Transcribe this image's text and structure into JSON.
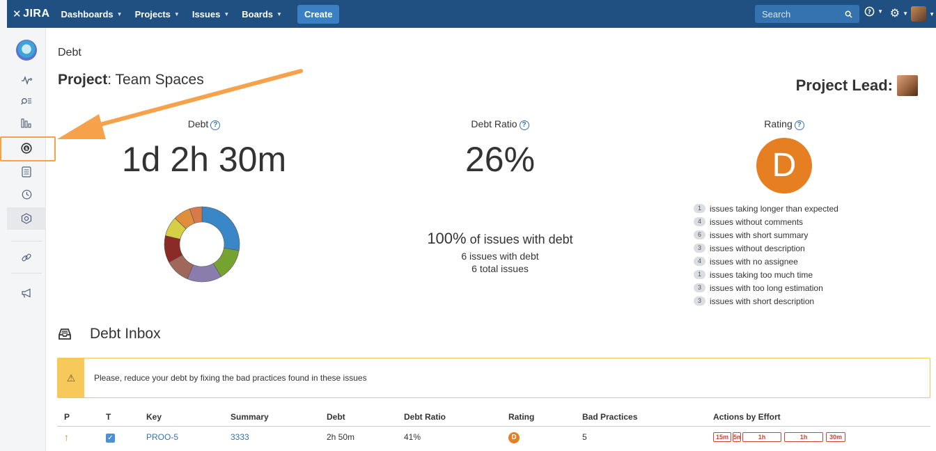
{
  "topbar": {
    "logo_text": "JIRA",
    "nav": [
      {
        "label": "Dashboards"
      },
      {
        "label": "Projects"
      },
      {
        "label": "Issues"
      },
      {
        "label": "Boards"
      }
    ],
    "create_label": "Create",
    "search_placeholder": "Search",
    "icons": [
      "search-icon",
      "help-icon",
      "gear-icon",
      "user-avatar"
    ]
  },
  "sidebar": {
    "icons": [
      "project-avatar",
      "activity-icon",
      "search-list-icon",
      "reports-icon",
      "debt-icon",
      "backlog-icon",
      "clock-icon",
      "components-icon",
      "link-icon",
      "megaphone-icon"
    ]
  },
  "page": {
    "breadcrumb": "Debt",
    "project_label": "Project",
    "project_name": ": Team Spaces",
    "project_lead_label": "Project Lead:"
  },
  "metrics": {
    "debt_label": "Debt",
    "debt_value": "1d 2h 30m",
    "ratio_label": "Debt Ratio",
    "ratio_value": "26%",
    "rating_label": "Rating",
    "rating_value": "D",
    "rating_color": "#e67e22"
  },
  "donut": {
    "segments": [
      {
        "value": 26,
        "color": "#3a87c8"
      },
      {
        "value": 13,
        "color": "#76a330"
      },
      {
        "value": 14,
        "color": "#8a7cad"
      },
      {
        "value": 10,
        "color": "#a0685a"
      },
      {
        "value": 11,
        "color": "#8b2a26"
      },
      {
        "value": 8,
        "color": "#d6cf45"
      },
      {
        "value": 7,
        "color": "#e08d3c"
      },
      {
        "value": 5,
        "color": "#d67a4a"
      }
    ]
  },
  "summary": {
    "pct": "100%",
    "pct_text": "of issues with debt",
    "with_debt": "6 issues with debt",
    "total": "6 total issues"
  },
  "bad_practices": [
    {
      "count": "1",
      "label": "issues taking longer than expected"
    },
    {
      "count": "4",
      "label": "issues without comments"
    },
    {
      "count": "6",
      "label": "issues with short summary"
    },
    {
      "count": "3",
      "label": "issues without description"
    },
    {
      "count": "4",
      "label": "issues with no assignee"
    },
    {
      "count": "1",
      "label": "issues taking too much time"
    },
    {
      "count": "3",
      "label": "issues with too long estimation"
    },
    {
      "count": "3",
      "label": "issues with short description"
    }
  ],
  "inbox": {
    "title": "Debt Inbox",
    "warning": "Please, reduce your debt by fixing the bad practices found in these issues",
    "columns": [
      "P",
      "T",
      "Key",
      "Summary",
      "Debt",
      "Debt Ratio",
      "Rating",
      "Bad Practices",
      "Actions by Effort"
    ],
    "rows": [
      {
        "key": "PROO-5",
        "summary": "3333",
        "debt": "2h 50m",
        "ratio": "41%",
        "rating": "D",
        "bad_practices": "5",
        "efforts": [
          "15m",
          "5m",
          "1h",
          "1h",
          "30m"
        ]
      }
    ]
  }
}
